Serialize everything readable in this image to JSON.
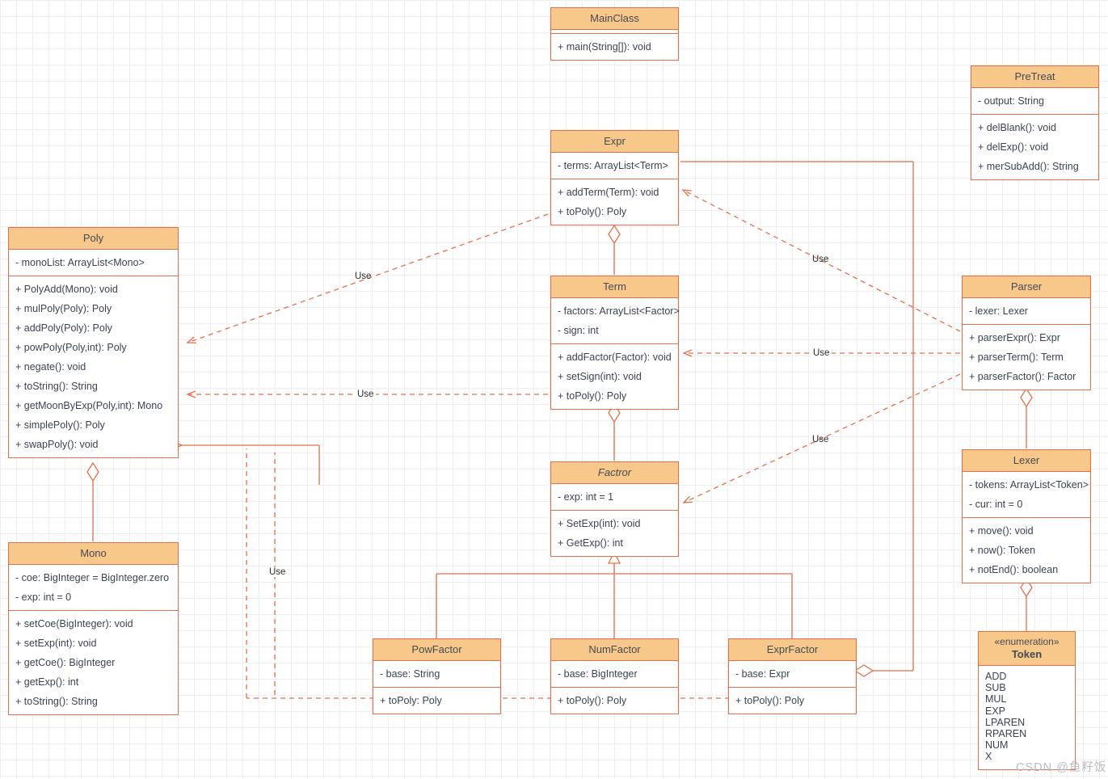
{
  "diagram": {
    "type": "uml-class-diagram",
    "colors": {
      "border": "#e2704a",
      "title_fill": "#f7c88a",
      "text": "#3b4252",
      "connector": "#e2704a",
      "grid_minor": "#eeeeee",
      "grid_major": "#dddddd",
      "watermark": "#b9bcc2"
    },
    "watermark": "CSDN @鱼籽饭",
    "classes": [
      {
        "id": "mainclass",
        "name": "MainClass",
        "stereotype": "",
        "abstract": false,
        "attributes": [],
        "methods": [
          "+ main(String[]): void"
        ]
      },
      {
        "id": "pretreat",
        "name": "PreTreat",
        "stereotype": "",
        "abstract": false,
        "attributes": [
          "- output: String"
        ],
        "methods": [
          "+ delBlank(): void",
          "+ delExp(): void",
          "+ merSubAdd(): String"
        ]
      },
      {
        "id": "expr",
        "name": "Expr",
        "stereotype": "",
        "abstract": false,
        "attributes": [
          "- terms: ArrayList<Term>"
        ],
        "methods": [
          "+ addTerm(Term): void",
          "+ toPoly(): Poly"
        ]
      },
      {
        "id": "poly",
        "name": "Poly",
        "stereotype": "",
        "abstract": false,
        "attributes": [
          "- monoList: ArrayList<Mono>"
        ],
        "methods": [
          "+ PolyAdd(Mono): void",
          "+ mulPoly(Poly): Poly",
          "+ addPoly(Poly): Poly",
          "+ powPoly(Poly,int): Poly",
          "+ negate(): void",
          "+ toString(): String",
          "+ getMoonByExp(Poly,int): Mono",
          "+ simplePoly(): Poly",
          "+ swapPoly(): void"
        ]
      },
      {
        "id": "term",
        "name": "Term",
        "stereotype": "",
        "abstract": false,
        "attributes": [
          "- factors: ArrayList<Factor>",
          "- sign: int"
        ],
        "methods": [
          "+ addFactor(Factor): void",
          "+ setSign(int): void",
          "+ toPoly(): Poly"
        ]
      },
      {
        "id": "parser",
        "name": "Parser",
        "stereotype": "",
        "abstract": false,
        "attributes": [
          "- lexer: Lexer"
        ],
        "methods": [
          "+ parserExpr(): Expr",
          "+ parserTerm(): Term",
          "+ parserFactor(): Factor"
        ]
      },
      {
        "id": "factror",
        "name": "Factror",
        "stereotype": "",
        "abstract": true,
        "attributes": [
          "- exp: int = 1"
        ],
        "methods": [
          "+ SetExp(int): void",
          "+ GetExp(): int"
        ]
      },
      {
        "id": "lexer",
        "name": "Lexer",
        "stereotype": "",
        "abstract": false,
        "attributes": [
          "- tokens: ArrayList<Token>",
          "- cur: int = 0"
        ],
        "methods": [
          "+ move(): void",
          "+ now(): Token",
          "+ notEnd(): boolean"
        ]
      },
      {
        "id": "mono",
        "name": "Mono",
        "stereotype": "",
        "abstract": false,
        "attributes": [
          "- coe: BigInteger = BigInteger.zero",
          "- exp: int = 0"
        ],
        "methods": [
          "+ setCoe(BigInteger): void",
          "+ setExp(int): void",
          "+ getCoe(): BigInteger",
          "+ getExp(): int",
          "+ toString(): String"
        ]
      },
      {
        "id": "powfactor",
        "name": "PowFactor",
        "stereotype": "",
        "abstract": false,
        "attributes": [
          "- base: String"
        ],
        "methods": [
          "+ toPoly: Poly"
        ]
      },
      {
        "id": "numfactor",
        "name": "NumFactor",
        "stereotype": "",
        "abstract": false,
        "attributes": [
          "- base: BigInteger"
        ],
        "methods": [
          "+ toPoly(): Poly"
        ]
      },
      {
        "id": "exprfactor",
        "name": "ExprFactor",
        "stereotype": "",
        "abstract": false,
        "attributes": [
          "- base: Expr"
        ],
        "methods": [
          "+ toPoly(): Poly"
        ]
      },
      {
        "id": "token",
        "name": "Token",
        "stereotype": "«enumeration»",
        "abstract": false,
        "attributes": [],
        "literals": [
          "ADD",
          "SUB",
          "MUL",
          "EXP",
          "LPAREN",
          "RPAREN",
          "NUM",
          "X"
        ],
        "methods": []
      }
    ],
    "edge_labels": [
      {
        "id": "use-poly-expr",
        "text": "Use"
      },
      {
        "id": "use-expr-parser",
        "text": "Use"
      },
      {
        "id": "use-poly-term",
        "text": "Use"
      },
      {
        "id": "use-term-parser",
        "text": "Use"
      },
      {
        "id": "use-factror-parser",
        "text": "Use"
      },
      {
        "id": "use-mono-factors",
        "text": "Use"
      }
    ]
  }
}
